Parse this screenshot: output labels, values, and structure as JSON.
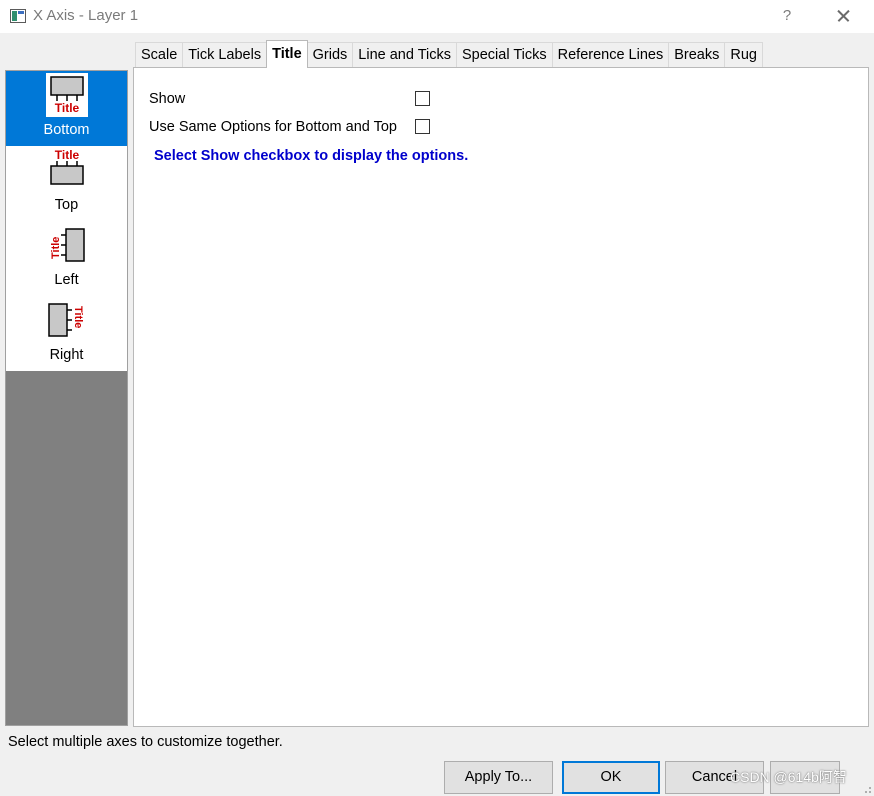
{
  "window": {
    "title": "X Axis - Layer 1",
    "help_label": "?"
  },
  "tabs": [
    {
      "label": "Scale"
    },
    {
      "label": "Tick Labels"
    },
    {
      "label": "Title",
      "active": true
    },
    {
      "label": "Grids"
    },
    {
      "label": "Line and Ticks"
    },
    {
      "label": "Special Ticks"
    },
    {
      "label": "Reference Lines"
    },
    {
      "label": "Breaks"
    },
    {
      "label": "Rug"
    }
  ],
  "axes": [
    {
      "label": "Bottom",
      "icon_text": "Title",
      "selected": true
    },
    {
      "label": "Top",
      "icon_text": "Title"
    },
    {
      "label": "Left",
      "icon_text": "Title"
    },
    {
      "label": "Right",
      "icon_text": "Title"
    }
  ],
  "options": {
    "show_label": "Show",
    "show_checked": false,
    "same_options_label": "Use Same Options for Bottom and Top",
    "same_options_checked": false,
    "info_text": "Select Show checkbox to display the options."
  },
  "status_text": "Select multiple axes to customize together.",
  "buttons": {
    "apply_to": "Apply To...",
    "ok": "OK",
    "cancel": "Cancel"
  },
  "watermark": "CSDN @614b阿智",
  "colors": {
    "selection": "#0078d7",
    "info_text": "#0000cc",
    "icon_title": "#cc0000"
  }
}
